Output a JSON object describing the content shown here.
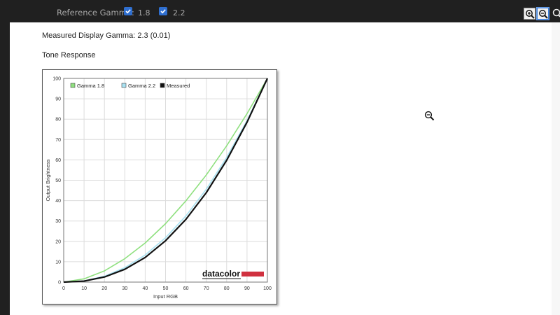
{
  "toolbar": {
    "reference_label": "Reference Gamma:",
    "options": [
      {
        "label": "1.8",
        "checked": true
      },
      {
        "label": "2.2",
        "checked": true
      }
    ],
    "zoom_in_icon": "zoom-in-icon",
    "zoom_out_icon": "zoom-out-icon"
  },
  "content": {
    "measured_text": "Measured Display Gamma: 2.3 (0.01)",
    "section_title": "Tone Response"
  },
  "colors": {
    "gamma18": "#8fe07f",
    "gamma22": "#a9e2f2",
    "measured": "#111111",
    "brand_bar": "#d0313f",
    "checkbox": "#2f6fd0"
  },
  "chart_data": {
    "type": "line",
    "xlabel": "Input RGB",
    "ylabel": "Output Brightness",
    "xlim": [
      0,
      100
    ],
    "ylim": [
      0,
      100
    ],
    "xticks": [
      0,
      10,
      20,
      30,
      40,
      50,
      60,
      70,
      80,
      90,
      100
    ],
    "yticks": [
      0,
      10,
      20,
      30,
      40,
      50,
      60,
      70,
      80,
      90,
      100
    ],
    "grid": true,
    "legend_position": "top-left",
    "x": [
      0,
      10,
      20,
      30,
      40,
      50,
      60,
      70,
      80,
      90,
      100
    ],
    "series": [
      {
        "name": "Gamma 1.8",
        "values": [
          0,
          1.6,
          5.5,
          11.5,
          19.2,
          28.7,
          39.9,
          52.6,
          66.9,
          82.7,
          100
        ]
      },
      {
        "name": "Gamma 2.2",
        "values": [
          0,
          0.6,
          2.9,
          7.1,
          13.3,
          21.8,
          32.5,
          45.6,
          61.2,
          79.3,
          100
        ]
      },
      {
        "name": "Measured",
        "values": [
          0,
          0.5,
          2.5,
          6.3,
          12.1,
          20.3,
          30.8,
          43.9,
          59.8,
          78.5,
          100
        ]
      }
    ],
    "watermark": "datacolor"
  }
}
